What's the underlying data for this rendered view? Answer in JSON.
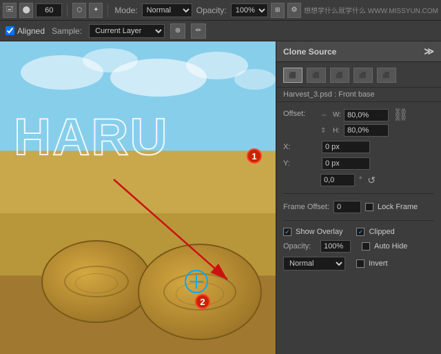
{
  "topToolbar": {
    "toolIcon1": "stamp-tool",
    "sizeLabel": "60",
    "modeLabel": "Mode:",
    "modeValue": "Normal",
    "opacityLabel": "Opacity:",
    "opacityValue": "100%",
    "watermark": "想想学什么就学什么  WWW.MISSYUN.COM"
  },
  "secondToolbar": {
    "alignedLabel": "Aligned",
    "sampleLabel": "Sample:",
    "sampleValue": "Current Layer"
  },
  "clonePanel": {
    "title": "Clone Source",
    "sourceIcons": [
      "1",
      "2",
      "3",
      "4",
      "5"
    ],
    "filename": "Harvest_3.psd : Front base",
    "offsetLabel": "Offset:",
    "wLabel": "W:",
    "wValue": "80,0%",
    "hLabel": "H:",
    "hValue": "80,0%",
    "xLabel": "X:",
    "xValue": "0 px",
    "yLabel": "Y:",
    "yValue": "0 px",
    "rotationValue": "0,0",
    "rotationUnit": "°",
    "frameOffsetLabel": "Frame Offset:",
    "frameOffsetValue": "0",
    "lockFrameLabel": "Lock Frame",
    "showOverlayLabel": "Show Overlay",
    "showOverlayChecked": true,
    "clippedLabel": "Clipped",
    "clippedChecked": true,
    "opacityLabel": "Opacity:",
    "opacityValue": "100%",
    "autoHideLabel": "Auto Hide",
    "autoHideChecked": false,
    "normalLabel": "Normal",
    "invertLabel": "Invert",
    "invertChecked": false,
    "badge1": "1",
    "badge2": "2"
  },
  "canvas": {
    "textOverlay": "HARU",
    "badge1Text": "1",
    "badge2Text": "2"
  }
}
